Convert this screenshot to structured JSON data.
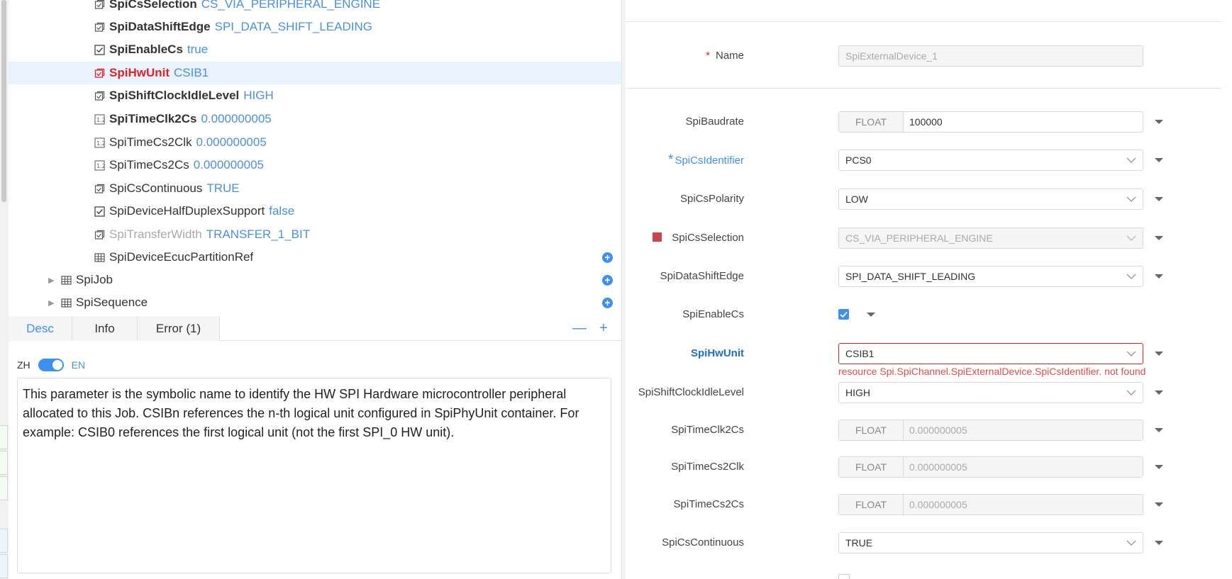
{
  "tree": {
    "items": [
      {
        "name": "SpiCsSelection",
        "value": "CS_VIA_PERIPHERAL_ENGINE",
        "style": "bold",
        "icon": "checkbox-ref-icon"
      },
      {
        "name": "SpiDataShiftEdge",
        "value": "SPI_DATA_SHIFT_LEADING",
        "style": "bold",
        "icon": "checkbox-ref-icon"
      },
      {
        "name": "SpiEnableCs",
        "value": "true",
        "style": "bold",
        "icon": "checkbox-checked-icon"
      },
      {
        "name": "SpiHwUnit",
        "value": "CSIB1",
        "style": "red",
        "icon": "checkbox-ref-error-icon"
      },
      {
        "name": "SpiShiftClockIdleLevel",
        "value": "HIGH",
        "style": "bold",
        "icon": "checkbox-ref-icon"
      },
      {
        "name": "SpiTimeClk2Cs",
        "value": "0.000000005",
        "style": "bold",
        "icon": "float-param-icon"
      },
      {
        "name": "SpiTimeCs2Clk",
        "value": "0.000000005",
        "style": "normal",
        "icon": "float-param-icon"
      },
      {
        "name": "SpiTimeCs2Cs",
        "value": "0.000000005",
        "style": "normal",
        "icon": "float-param-icon"
      },
      {
        "name": "SpiCsContinuous",
        "value": "TRUE",
        "style": "normal",
        "icon": "checkbox-ref-icon"
      },
      {
        "name": "SpiDeviceHalfDuplexSupport",
        "value": "false",
        "style": "normal",
        "icon": "checkbox-checked-icon"
      },
      {
        "name": "SpiTransferWidth",
        "value": "TRANSFER_1_BIT",
        "style": "gray",
        "icon": "checkbox-ref-icon"
      },
      {
        "name": "SpiDeviceEcucPartitionRef",
        "value": "",
        "style": "normal",
        "icon": "table-icon"
      }
    ],
    "containers": [
      {
        "name": "SpiJob"
      },
      {
        "name": "SpiSequence"
      }
    ]
  },
  "tabs": {
    "desc": "Desc",
    "info": "Info",
    "error": "Error (1)",
    "minus": "—",
    "plus": "+"
  },
  "lang": {
    "zh": "ZH",
    "en": "EN"
  },
  "description": "This parameter is the symbolic name to identify the HW SPI Hardware microcontroller peripheral allocated to this Job. CSIBn references the n-th logical unit configured in SpiPhyUnit container. For example: CSIB0 references the first logical unit (not the first SPI_0 HW unit).",
  "form": {
    "name": {
      "label": "Name",
      "required": "*",
      "value": "SpiExternalDevice_1"
    },
    "baudrate": {
      "label": "SpiBaudrate",
      "type": "FLOAT",
      "value": "100000"
    },
    "csIdentifier": {
      "label": "SpiCsIdentifier",
      "required": "*",
      "value": "PCS0"
    },
    "csPolarity": {
      "label": "SpiCsPolarity",
      "value": "LOW"
    },
    "csSelection": {
      "label": "SpiCsSelection",
      "value": "CS_VIA_PERIPHERAL_ENGINE"
    },
    "dataShiftEdge": {
      "label": "SpiDataShiftEdge",
      "value": "SPI_DATA_SHIFT_LEADING"
    },
    "enableCs": {
      "label": "SpiEnableCs",
      "checked": true
    },
    "hwUnit": {
      "label": "SpiHwUnit",
      "value": "CSIB1",
      "error": "resource Spi.SpiChannel.SpiExternalDevice.SpiCsIdentifier. not found"
    },
    "shiftClockIdle": {
      "label": "SpiShiftClockIdleLevel",
      "value": "HIGH"
    },
    "timeClk2Cs": {
      "label": "SpiTimeClk2Cs",
      "type": "FLOAT",
      "value": "0.000000005"
    },
    "timeCs2Clk": {
      "label": "SpiTimeCs2Clk",
      "type": "FLOAT",
      "value": "0.000000005"
    },
    "timeCs2Cs": {
      "label": "SpiTimeCs2Cs",
      "type": "FLOAT",
      "value": "0.000000005"
    },
    "csContinuous": {
      "label": "SpiCsContinuous",
      "value": "TRUE"
    }
  },
  "colors": {
    "accent": "#3d8ff0",
    "error": "#e02424",
    "value": "#4a90e2"
  }
}
